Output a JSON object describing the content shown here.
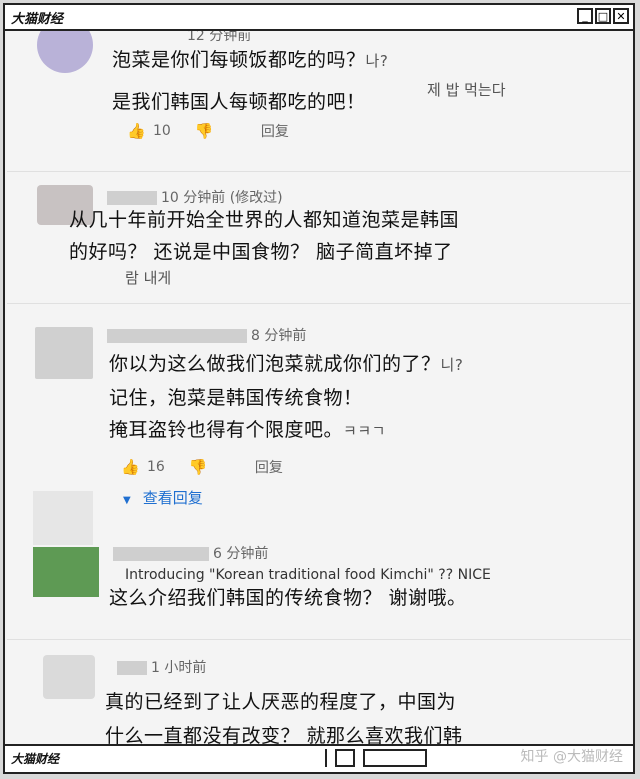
{
  "window": {
    "title": "大猫财经",
    "buttons": [
      "_",
      "□",
      "✕"
    ]
  },
  "comments": [
    {
      "time": "12 分钟前",
      "lines": [
        "泡菜是你们每顿饭都吃的吗？",
        "是我们韩国人每顿都吃的吧！"
      ],
      "korean_tail": "나?",
      "korean_line": "제 밥 먹는다",
      "likes": "10",
      "reply": "回复"
    },
    {
      "time": "10 分钟前 (修改过)",
      "lines": [
        "从几十年前开始全世界的人都知道泡菜是韩国",
        "的好吗？ 还说是中国食物？ 脑子简直坏掉了"
      ],
      "korean_line": "람 내게"
    },
    {
      "time": "8 分钟前",
      "lines": [
        "你以为这么做我们泡菜就成你们的了？",
        "记住，泡菜是韩国传统食物！",
        "掩耳盗铃也得有个限度吧。"
      ],
      "korean_tail": "니?",
      "korean_tail3": "ㅋㅋㄱ",
      "likes": "16",
      "reply": "回复",
      "view_replies": "查看回复"
    },
    {
      "time": "6 分钟前",
      "english": "Introducing \"Korean traditional food Kimchi\" ?? NICE",
      "lines": [
        "这么介绍我们韩国的传统食物？ 谢谢哦。"
      ]
    },
    {
      "time": "1 小时前",
      "lines": [
        "真的已经到了让人厌恶的程度了，中国为",
        "什么一直都没有改变？ 就那么喜欢我们韩"
      ]
    }
  ],
  "footer": {
    "title": "大猫财经",
    "watermark": "知乎 @大猫财经"
  },
  "colors": {
    "link": "#1f6fd0",
    "frame": "#222222"
  }
}
